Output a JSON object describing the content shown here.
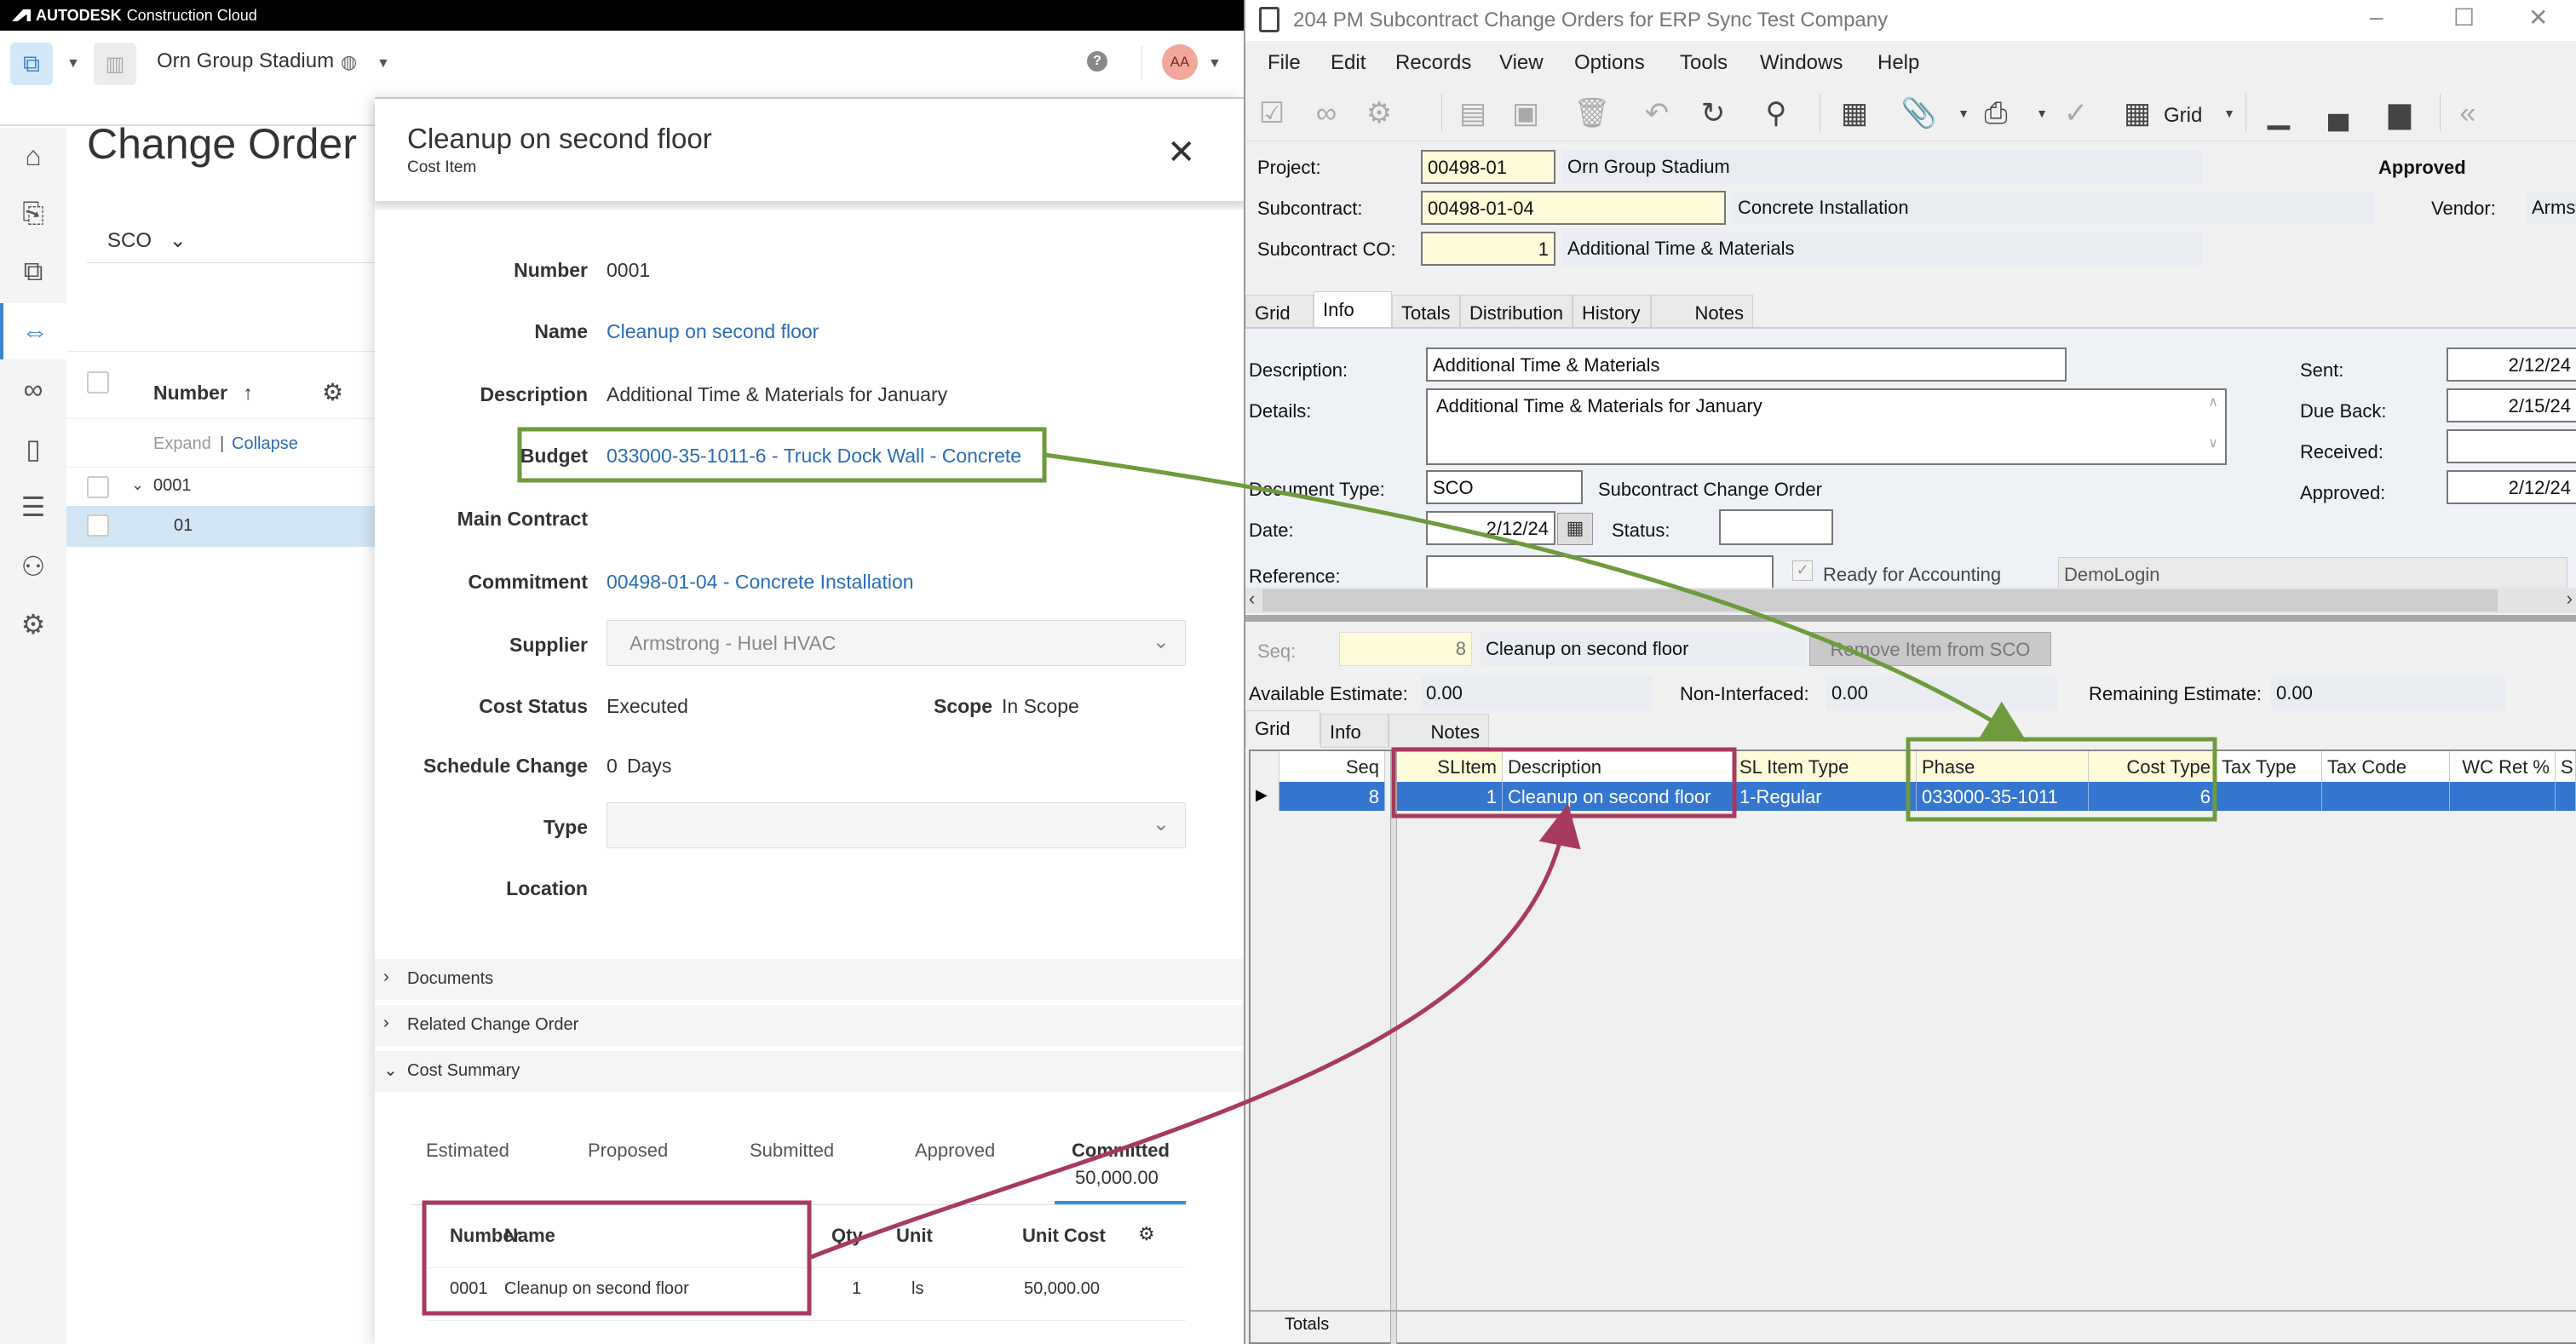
{
  "acc": {
    "brand": "AUTODESK",
    "brand_sub": "Construction Cloud",
    "project_name": "Orn Group Stadium",
    "avatar_initials": "AA",
    "help_glyph": "?",
    "page_title": "Change Order",
    "type_selector": "SCO",
    "list": {
      "column_header": "Number",
      "expand_label": "Expand",
      "collapse_label": "Collapse",
      "divider": "|",
      "rows": [
        {
          "number": "0001",
          "expanded": true
        },
        {
          "number": "01",
          "selected": true
        }
      ]
    },
    "nav_icons": [
      "home-icon",
      "cost-export-icon",
      "cost-transfer-icon",
      "change-order-icon",
      "binoculars-icon",
      "document-icon",
      "report-icon",
      "members-icon",
      "settings-icon"
    ],
    "panel": {
      "title": "Cleanup on second floor",
      "subtitle": "Cost Item",
      "fields": {
        "number": {
          "label": "Number",
          "value": "0001"
        },
        "name": {
          "label": "Name",
          "value": "Cleanup on second floor"
        },
        "description": {
          "label": "Description",
          "value": "Additional Time & Materials for January"
        },
        "budget": {
          "label": "Budget",
          "value": "033000-35-1011-6 - Truck Dock Wall - Concrete"
        },
        "main_contract": {
          "label": "Main Contract",
          "value": ""
        },
        "commitment": {
          "label": "Commitment",
          "value": "00498-01-04 - Concrete Installation"
        },
        "supplier": {
          "label": "Supplier",
          "value": "Armstrong - Huel HVAC"
        },
        "cost_status": {
          "label": "Cost Status",
          "value": "Executed"
        },
        "scope": {
          "label": "Scope",
          "value": "In Scope"
        },
        "schedule_change": {
          "label": "Schedule Change",
          "value": "0",
          "unit": "Days"
        },
        "type": {
          "label": "Type",
          "value": ""
        },
        "location": {
          "label": "Location",
          "value": ""
        }
      },
      "sections": [
        "Documents",
        "Related Change Order",
        "Cost Summary"
      ],
      "cost_summary": {
        "tabs": [
          {
            "label": "Estimated",
            "value": ""
          },
          {
            "label": "Proposed",
            "value": ""
          },
          {
            "label": "Submitted",
            "value": ""
          },
          {
            "label": "Approved",
            "value": ""
          },
          {
            "label": "Committed",
            "value": "50,000.00",
            "active": true
          }
        ],
        "columns": [
          "Number",
          "Name",
          "Qty",
          "Unit",
          "Unit Cost"
        ],
        "rows": [
          {
            "number": "0001",
            "name": "Cleanup on second floor",
            "qty": "1",
            "unit": "ls",
            "unit_cost": "50,000.00"
          }
        ]
      }
    }
  },
  "vista": {
    "window_title": "204 PM Subcontract Change Orders for ERP Sync Test Company",
    "menu": [
      "File",
      "Edit",
      "Records",
      "View",
      "Options",
      "Tools",
      "Windows",
      "Help"
    ],
    "toolbar_grid_label": "Grid",
    "header": {
      "project_label": "Project:",
      "project_code": "00498-01",
      "project_name": "Orn Group Stadium",
      "status": "Approved",
      "subcontract_label": "Subcontract:",
      "subcontract_code": "00498-01-04",
      "subcontract_name": "Concrete Installation",
      "vendor_label": "Vendor:",
      "vendor_value": "Armst",
      "sco_label": "Subcontract CO:",
      "sco_value": "1",
      "sco_desc": "Additional Time & Materials"
    },
    "tabs": [
      "Grid",
      "Info",
      "Totals",
      "Distribution",
      "History",
      "Notes"
    ],
    "active_tab": "Info",
    "info": {
      "description_label": "Description:",
      "description": "Additional Time & Materials",
      "details_label": "Details:",
      "details": "Additional Time & Materials for January",
      "doc_type_label": "Document Type:",
      "doc_type": "SCO",
      "doc_type_desc": "Subcontract Change Order",
      "date_label": "Date:",
      "date": "2/12/24",
      "status_label": "Status:",
      "status": "",
      "reference_label": "Reference:",
      "reference": "",
      "ready_label": "Ready for Accounting",
      "ready_checked": true,
      "login": "DemoLogin",
      "sent_label": "Sent:",
      "sent": "2/12/24",
      "due_back_label": "Due Back:",
      "due_back": "2/15/24",
      "received_label": "Received:",
      "received": "",
      "approved_label": "Approved:",
      "approved": "2/12/24"
    },
    "item": {
      "seq_label": "Seq:",
      "seq": "8",
      "seq_desc": "Cleanup on second floor",
      "remove_button": "Remove Item from SCO",
      "available_estimate_label": "Available Estimate:",
      "available_estimate": "0.00",
      "non_interfaced_label": "Non-Interfaced:",
      "non_interfaced": "0.00",
      "remaining_estimate_label": "Remaining Estimate:",
      "remaining_estimate": "0.00"
    },
    "item_tabs": [
      "Grid",
      "Info",
      "Notes"
    ],
    "grid": {
      "columns": [
        "Seq",
        "SLItem",
        "Description",
        "SL Item Type",
        "Phase",
        "Cost Type",
        "Tax Type",
        "Tax Code",
        "WC Ret %",
        "S"
      ],
      "rows": [
        {
          "seq": "8",
          "slitem": "1",
          "description": "Cleanup on second floor",
          "sl_item_type": "1-Regular",
          "phase": "033000-35-1011",
          "cost_type": "6",
          "tax_type": "",
          "tax_code": "",
          "wc_ret": "",
          "s": ""
        }
      ],
      "totals_label": "Totals"
    }
  },
  "annotations": {
    "green_color": "#6f9a3e",
    "maroon_color": "#a83a5e"
  }
}
